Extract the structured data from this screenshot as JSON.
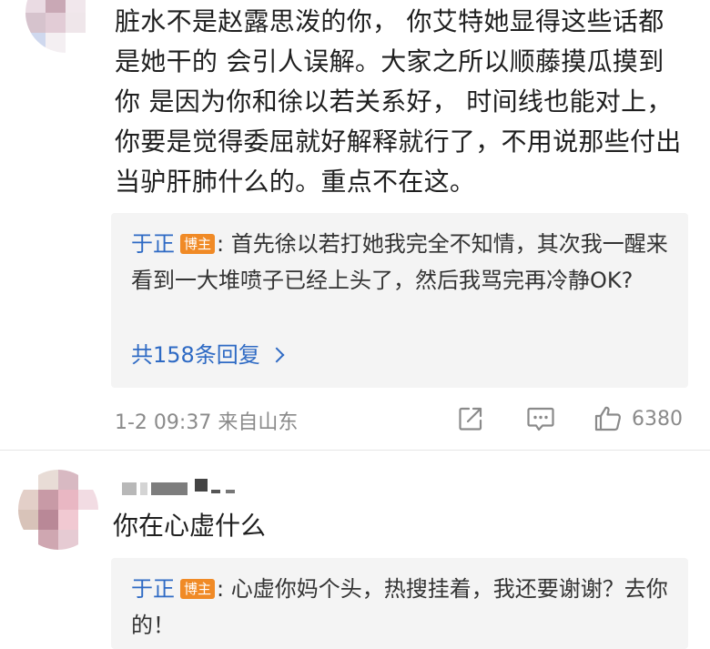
{
  "comment1": {
    "avatar_colors": [
      "#e9dde4",
      "#f3eef0",
      "#d9c9d1",
      "#f7f4f6",
      "#eadbe3",
      "#c9a8b5",
      "#f1e7ec",
      "#ffffff",
      "#d6c3cd",
      "#e2ccd6",
      "#efe6ea",
      "#ffffff",
      "#cfd8ee",
      "#f4eff2",
      "#ffffff",
      "#ffffff"
    ],
    "text": "脏水不是赵露思泼的你， 你艾特她显得这些话都是她干的 会引人误解。大家之所以顺藤摸瓜摸到你 是因为你和徐以若关系好， 时间线也能对上，你要是觉得委屈就好解释就行了，不用说那些付出当驴肝肺什么的。重点不在这。",
    "reply": {
      "author": "于正",
      "badge": "博主",
      "text": ": 首先徐以若打她我完全不知情，其次我一醒来看到一大堆喷子已经上头了，然后我骂完再冷静OK?",
      "more": "共158条回复"
    },
    "meta": {
      "time_location": "1-2 09:37 来自山东",
      "share_icon": "share-icon",
      "comment_icon": "comment-icon",
      "like_icon": "thumbs-up-icon",
      "likes": "6380"
    }
  },
  "comment2": {
    "avatar_colors": [
      "#ffffff",
      "#e8dcd6",
      "#d8b9c2",
      "#ffffff",
      "#e3cfc8",
      "#c89aa6",
      "#e9b7c3",
      "#f2dce3",
      "#d8c3b9",
      "#b98897",
      "#f1c9d2",
      "#ffffff",
      "#ffffff",
      "#cfa7b1",
      "#e6cbd3",
      "#ffffff"
    ],
    "text": "你在心虚什么",
    "reply": {
      "author": "于正",
      "badge": "博主",
      "text": ": 心虚你妈个头，热搜挂着，我还要谢谢？去你的！"
    }
  },
  "colors": {
    "link_blue": "#2e6ac4",
    "badge_orange": "#f08a26",
    "reply_bg": "#f4f4f4",
    "meta_gray": "#8a8a8a"
  }
}
